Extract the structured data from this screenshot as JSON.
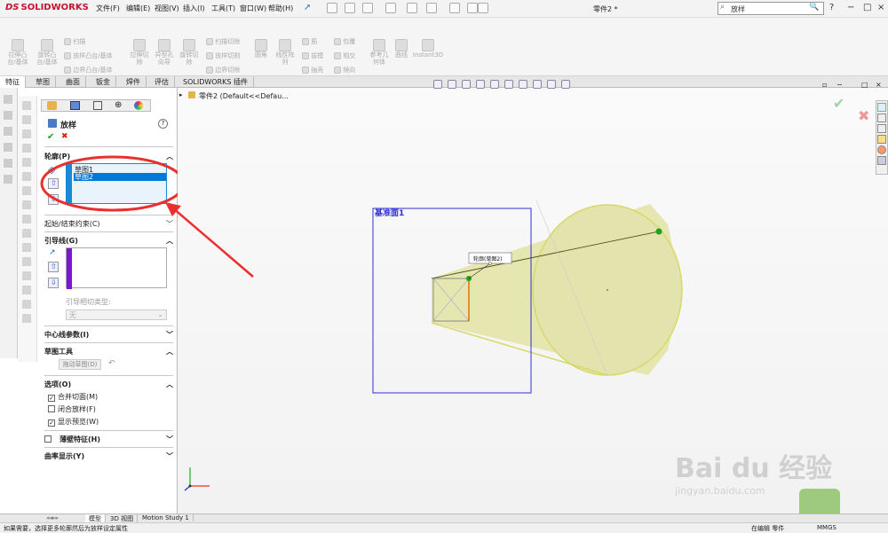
{
  "app": {
    "name": "SOLIDWORKS",
    "menus": [
      "文件(F)",
      "编辑(E)",
      "视图(V)",
      "插入(I)",
      "工具(T)",
      "窗口(W)",
      "帮助(H)"
    ],
    "doc_title": "零件2 *",
    "search_placeholder": "放样",
    "win_help": "?",
    "win_min": "−",
    "win_max": "□",
    "win_close": "×"
  },
  "ribbon": {
    "big": [
      "拉伸凸\n台/基体",
      "旋转凸\n台/基体",
      "拉伸切\n除",
      "异型孔\n向导",
      "旋转切\n除",
      "圆角",
      "线性阵\n列",
      "参考几\n何体",
      "曲线",
      "Instant3D"
    ],
    "small": [
      "扫描",
      "放样凸台/基体",
      "边界凸台/基体",
      "扫描切除",
      "放样切割",
      "边界切除",
      "筋",
      "拔模",
      "抽壳",
      "包覆",
      "相交",
      "镜向"
    ]
  },
  "tabs": [
    "特征",
    "草图",
    "曲面",
    "钣金",
    "焊件",
    "评估",
    "SOLIDWORKS 插件"
  ],
  "tree": {
    "label": "零件2 (Default<<Defau..."
  },
  "panel": {
    "title": "放样",
    "help": "?",
    "ok": "✔",
    "cancel": "✖",
    "profiles_header": "轮廓(P)",
    "profiles": [
      "草图1",
      "草图2"
    ],
    "start_end": "起始/结束约束(C)",
    "guides_header": "引导线(G)",
    "guide_tangency_label": "引导相切类型:",
    "guide_tangency_value": "无",
    "centerline": "中心线参数(I)",
    "sketch_tools": "草图工具",
    "drag_sketch": "拖动草图(D)",
    "options_header": "选项(O)",
    "options": [
      {
        "label": "合并切面(M)",
        "checked": true
      },
      {
        "label": "闭合放样(F)",
        "checked": false
      },
      {
        "label": "显示预览(W)",
        "checked": true
      }
    ],
    "thin_feature": "薄壁特征(H)",
    "curvature": "曲率显示(Y)"
  },
  "viewport": {
    "plane_label": "基准面1",
    "tooltip": "轮廓(草图2)"
  },
  "bottom_tabs": [
    "模型",
    "3D 视图",
    "Motion Study 1"
  ],
  "status": {
    "left": "如果需要，选择更多轮廓然后为放样设定属性",
    "editing": "在编辑 零件",
    "units": "MMGS"
  },
  "watermark": {
    "brand": "Bai du 经验",
    "url": "jingyan.baidu.com"
  },
  "colors": {
    "accent": "#0078d7",
    "annotation": "#e8302f",
    "cone_fill": "#e6e7b0",
    "plane": "#2e2ed6"
  }
}
